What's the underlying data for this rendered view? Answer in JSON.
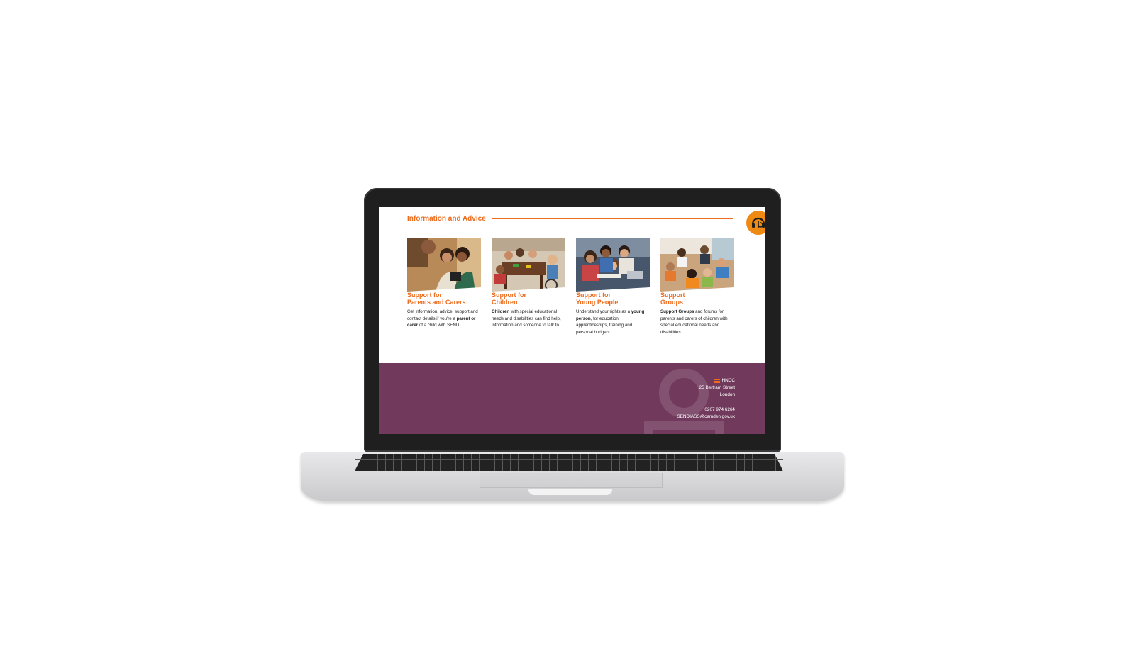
{
  "section": {
    "title": "Information and Advice"
  },
  "cards": [
    {
      "title_line1": "Support for",
      "title_line2": "Parents and Carers",
      "desc_pre": "Get information, advice, support and contact details if you're a ",
      "desc_bold": "parent or carer",
      "desc_post": " of a child with SEND.",
      "image": "parent-and-child-photo"
    },
    {
      "title_line1": "Support for",
      "title_line2": "Children",
      "desc_pre": "",
      "desc_bold": "Children",
      "desc_post": " with special educational needs and disabilities can find help, information and someone to talk to.",
      "image": "children-at-table-photo"
    },
    {
      "title_line1": "Support for",
      "title_line2": "Young People",
      "desc_pre": "Understand your rights as a ",
      "desc_bold": "young person",
      "desc_post": ", for education, apprenticeships, training and personal budgets.",
      "image": "young-people-laptop-photo"
    },
    {
      "title_line1": "Support",
      "title_line2": "Groups",
      "desc_pre": "",
      "desc_bold": "Support Groups",
      "desc_post": " and forums for parents and carers of children with special educational needs and disabilities.",
      "image": "support-group-photo"
    }
  ],
  "footer": {
    "org": "HNCC",
    "address_line1": "25 Bertram Street",
    "address_line2": "London",
    "phone": "0207 974 6264",
    "email": "SENDIASS@camden.gov.uk"
  },
  "colors": {
    "accent": "#ee6b1c",
    "badge": "#ee8a12",
    "footer_bg": "#713a5c"
  },
  "icons": {
    "badge": "headphones-accessibility-icon",
    "org": "hncc-logo-icon"
  }
}
